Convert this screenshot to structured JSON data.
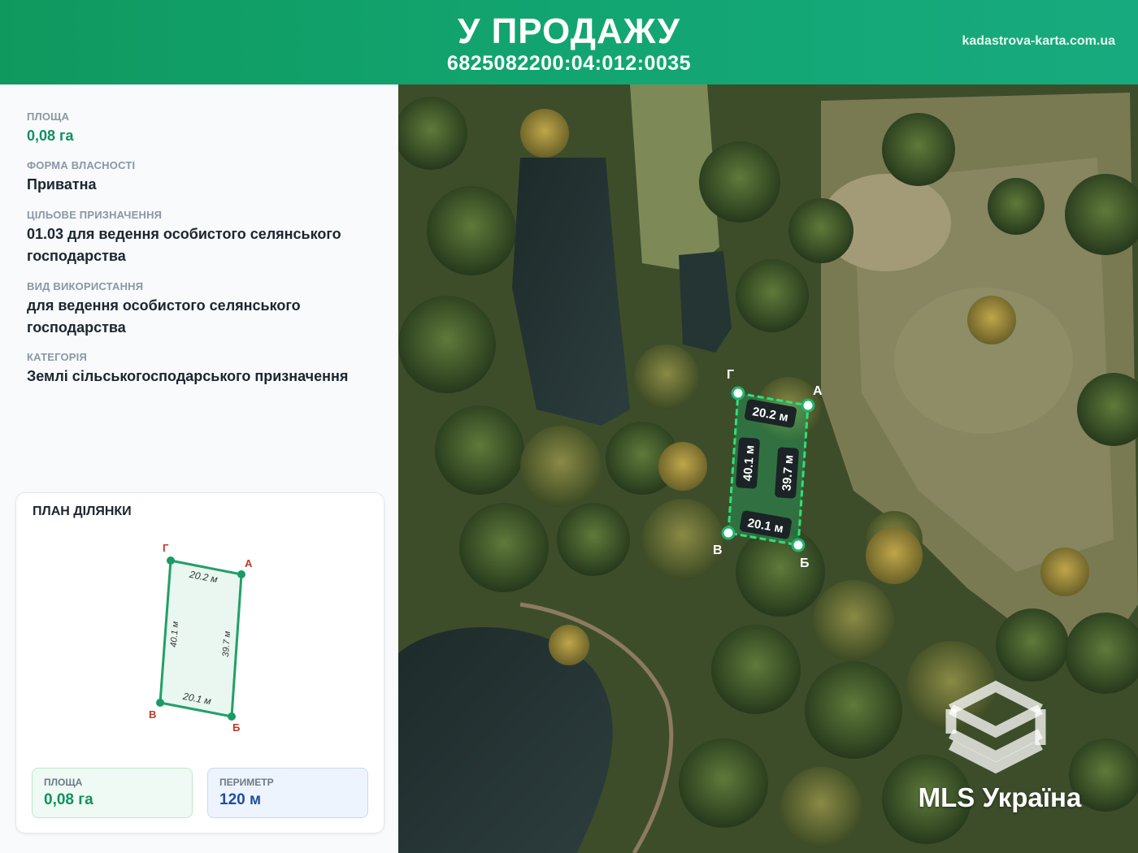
{
  "header": {
    "title": "У ПРОДАЖУ",
    "cadastral_number": "6825082200:04:012:0035",
    "site": "kadastrova-karta.com.ua"
  },
  "info": {
    "area_label": "ПЛОЩА",
    "area_value": "0,08 га",
    "ownership_label": "ФОРМА ВЛАСНОСТІ",
    "ownership_value": "Приватна",
    "purpose_label": "ЦІЛЬОВЕ ПРИЗНАЧЕННЯ",
    "purpose_value": "01.03 для ведення особистого селянського господарства",
    "usage_label": "ВИД ВИКОРИСТАННЯ",
    "usage_value": "для ведення особистого селянського господарства",
    "category_label": "КАТЕГОРІЯ",
    "category_value": "Землі сільськогосподарського призначення"
  },
  "plan": {
    "title": "ПЛАН ДІЛЯНКИ",
    "vertices": {
      "a": "А",
      "b": "Б",
      "v": "В",
      "g": "Г"
    },
    "sides": {
      "top": "20.2 м",
      "bottom": "20.1 м",
      "left": "40.1 м",
      "right": "39.7 м"
    },
    "area_label": "ПЛОЩА",
    "area_value": "0,08 га",
    "perimeter_label": "ПЕРИМЕТР",
    "perimeter_value": "120 м"
  },
  "map": {
    "vertices": {
      "a": "А",
      "b": "Б",
      "v": "В",
      "g": "Г"
    },
    "sides": {
      "top": "20.2 м",
      "bottom": "20.1 м",
      "left": "40.1 м",
      "right": "39.7 м"
    }
  },
  "watermark": {
    "brand": "MLS Україна"
  },
  "colors": {
    "header": "#12a571",
    "accent_green": "#11915d",
    "accent_blue": "#1d4fa0"
  }
}
